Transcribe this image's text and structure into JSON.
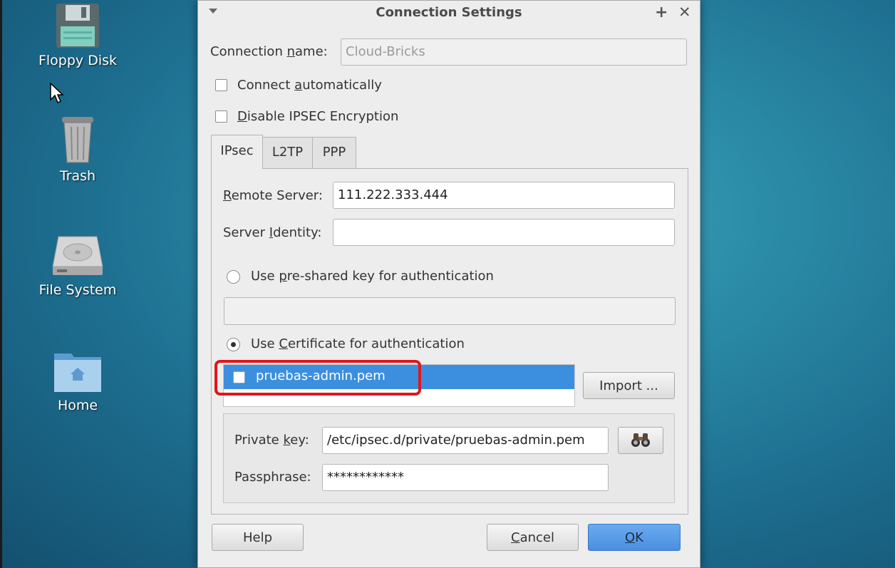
{
  "desktop": {
    "icons": [
      {
        "label": "Floppy Disk"
      },
      {
        "label": "Trash"
      },
      {
        "label": "File System"
      },
      {
        "label": "Home"
      }
    ]
  },
  "dialog": {
    "title": "Connection Settings",
    "connection_name": {
      "label_pre": "Connection ",
      "label_u": "n",
      "label_post": "ame:",
      "value": "Cloud-Bricks"
    },
    "connect_auto": {
      "pre": "Connect ",
      "u": "a",
      "post": "utomatically"
    },
    "disable_ipsec": {
      "pre": "",
      "u": "D",
      "post": "isable IPSEC Encryption"
    },
    "tabs": [
      "IPsec",
      "L2TP",
      "PPP"
    ],
    "remote_server": {
      "pre": "",
      "u": "R",
      "post": "emote Server:",
      "value": "111.222.333.444"
    },
    "server_identity": {
      "pre": "Server ",
      "u": "I",
      "post": "dentity:",
      "value": ""
    },
    "psk_option": {
      "pre": "Use ",
      "u": "p",
      "post": "re-shared key for authentication"
    },
    "cert_option": {
      "pre": "Use ",
      "u": "C",
      "post": "ertificate for authentication"
    },
    "certificates": [
      "pruebas-admin.pem"
    ],
    "import_label": "Import ...",
    "private_key": {
      "pre": "Private ",
      "u": "k",
      "post": "ey:",
      "value": "/etc/ipsec.d/private/pruebas-admin.pem"
    },
    "passphrase": {
      "label": "Passphrase:",
      "value": "************"
    },
    "buttons": {
      "help": "Help",
      "cancel": {
        "u": "C",
        "post": "ancel"
      },
      "ok": {
        "u": "O",
        "post": "K"
      }
    }
  },
  "colors": {
    "highlight": "#e0161a",
    "selection": "#3c8fde"
  }
}
